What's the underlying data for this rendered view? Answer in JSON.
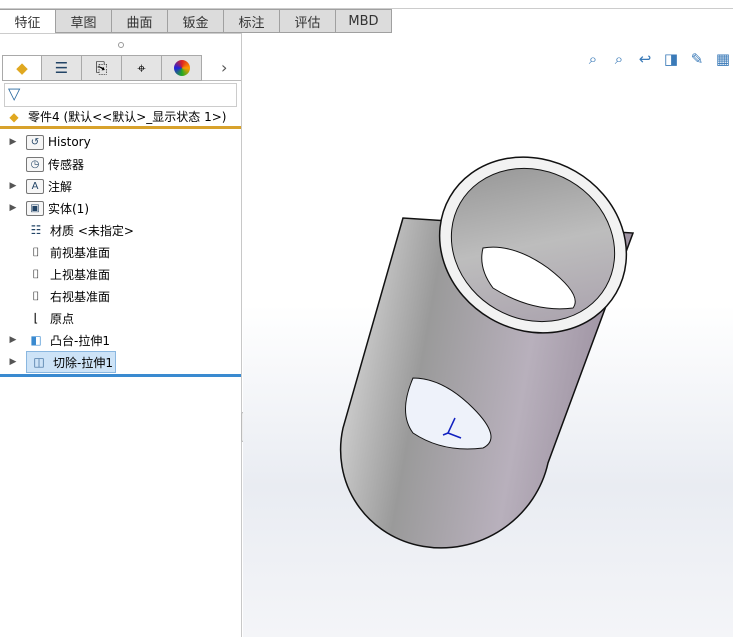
{
  "tabs": [
    "特征",
    "草图",
    "曲面",
    "钣金",
    "标注",
    "评估",
    "MBD"
  ],
  "panel": {
    "root": "零件4  (默认<<默认>_显示状态 1>)",
    "tree": [
      {
        "label": "History",
        "expandable": true,
        "icon": "history-folder-icon"
      },
      {
        "label": "传感器",
        "expandable": false,
        "icon": "sensor-folder-icon"
      },
      {
        "label": "注解",
        "expandable": true,
        "icon": "annotation-folder-icon"
      },
      {
        "label": "实体(1)",
        "expandable": true,
        "icon": "solid-body-folder-icon"
      },
      {
        "label": "材质 <未指定>",
        "expandable": false,
        "icon": "material-icon"
      },
      {
        "label": "前视基准面",
        "expandable": false,
        "icon": "plane-icon"
      },
      {
        "label": "上视基准面",
        "expandable": false,
        "icon": "plane-icon"
      },
      {
        "label": "右视基准面",
        "expandable": false,
        "icon": "plane-icon"
      },
      {
        "label": "原点",
        "expandable": false,
        "icon": "origin-icon"
      },
      {
        "label": "凸台-拉伸1",
        "expandable": true,
        "icon": "boss-extrude-icon"
      },
      {
        "label": "切除-拉伸1",
        "expandable": true,
        "icon": "cut-extrude-icon",
        "selected": true
      }
    ]
  }
}
